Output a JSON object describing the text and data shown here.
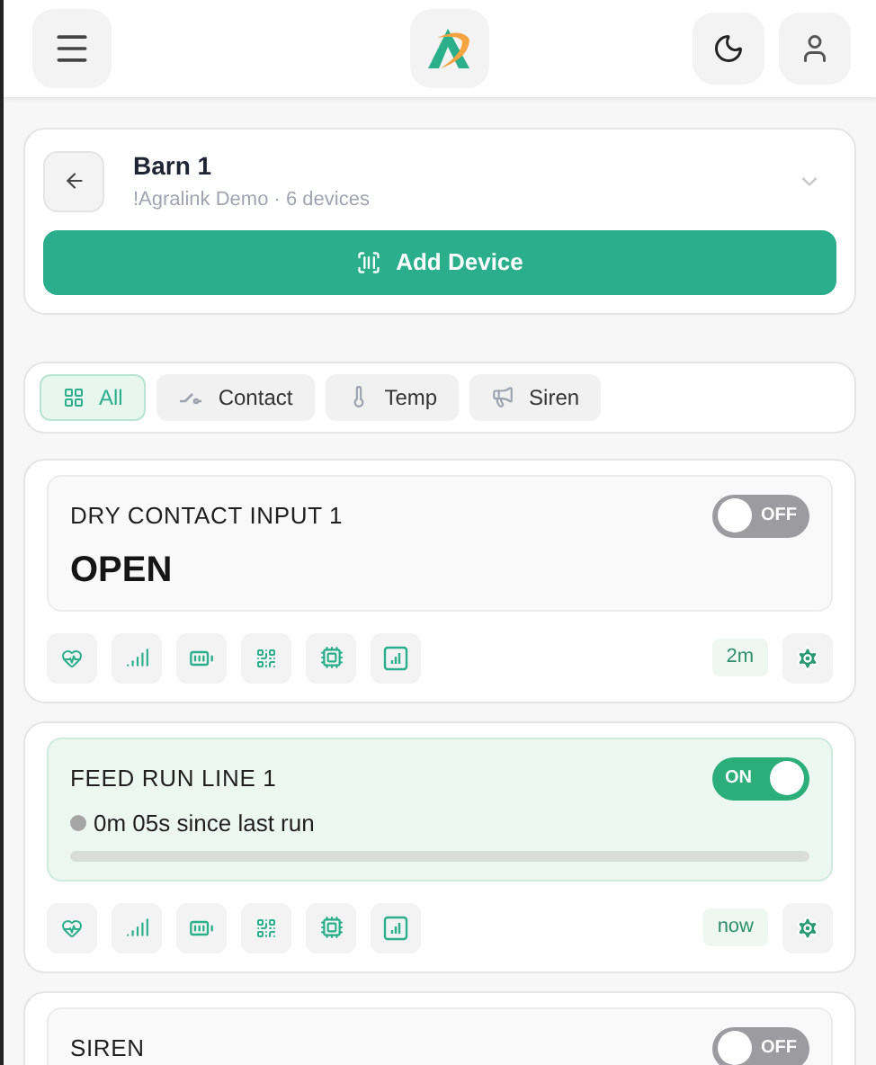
{
  "location": {
    "title": "Barn 1",
    "subtitle": "!Agralink Demo · 6 devices",
    "add_button": "Add Device"
  },
  "filters": [
    {
      "label": "All",
      "kind": "all",
      "selected": true
    },
    {
      "label": "Contact",
      "kind": "contact",
      "selected": false
    },
    {
      "label": "Temp",
      "kind": "temp",
      "selected": false
    },
    {
      "label": "Siren",
      "kind": "siren",
      "selected": false
    }
  ],
  "devices": [
    {
      "name": "DRY CONTACT INPUT 1",
      "kind": "contact",
      "on": false,
      "switch_label": "OFF",
      "status": "OPEN",
      "updated": "2m"
    },
    {
      "name": "FEED RUN LINE 1",
      "kind": "feed",
      "on": true,
      "switch_label": "ON",
      "status": "0m 05s since last run",
      "level": 0,
      "updated": "now"
    },
    {
      "name": "SIREN",
      "kind": "siren",
      "on": false,
      "switch_label": "OFF"
    }
  ]
}
